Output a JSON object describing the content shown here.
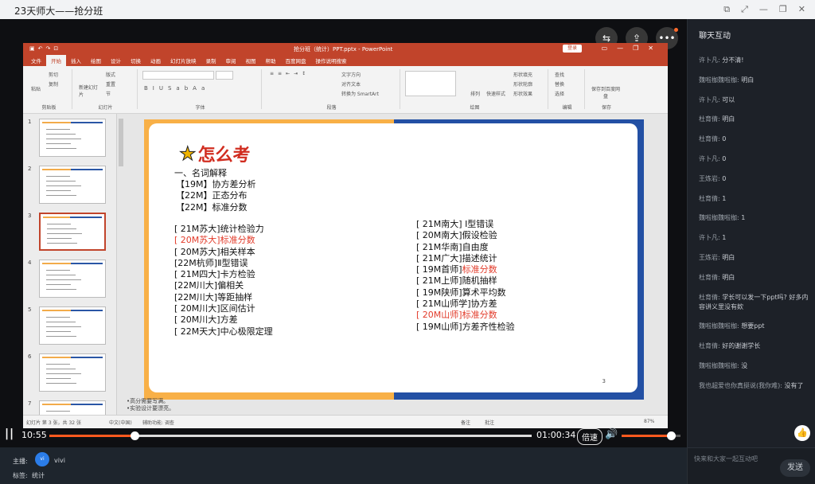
{
  "window": {
    "title": "23天师大——抢分班",
    "controls": [
      "⧉",
      "⤢",
      "—",
      "❐",
      "✕"
    ]
  },
  "player": {
    "current_time": "10:55",
    "total_time": "01:00:34",
    "speed_label": "倍速",
    "progress": 0.176,
    "volume_level": 0.85
  },
  "host": {
    "host_label": "主播:",
    "host_name": "vivi",
    "avatar_text": "vi",
    "tag_label": "标签:",
    "tag_value": "统计"
  },
  "ppt": {
    "file_title": "抢分班（统计）PPT.pptx - PowerPoint",
    "login_label": "登录",
    "tabs": [
      "文件",
      "开始",
      "插入",
      "绘图",
      "设计",
      "切换",
      "动画",
      "幻灯片放映",
      "录制",
      "审阅",
      "视图",
      "帮助",
      "百度网盘"
    ],
    "tell_me": "操作说明搜索",
    "ribbon_groups": [
      "剪贴板",
      "幻灯片",
      "字体",
      "段落",
      "绘图",
      "编辑",
      "保存"
    ],
    "ribbon_items": {
      "paste": "粘贴",
      "cut": "剪切",
      "copy": "复制",
      "new_slide": "新建幻灯片",
      "layout": "版式",
      "reset": "重置",
      "section": "节",
      "text_dir": "文字方向",
      "align_text": "对齐文本",
      "smartart": "转换为 SmartArt",
      "arrange": "排列",
      "quick_styles": "快速样式",
      "fill": "形状填充",
      "outline": "形状轮廓",
      "effect": "形状效果",
      "find": "查找",
      "replace": "替换",
      "select": "选择",
      "save_baidu": "保存到百度网盘"
    },
    "thumb_numbers": [
      "1",
      "2",
      "3",
      "4",
      "5",
      "6",
      "7"
    ],
    "notes": [
      "•高分需要写满。",
      "•实验设计要漂亮。"
    ],
    "status": {
      "slide_info": "幻灯片 第 3 张，共 32 张",
      "lang": "中文(中国)",
      "accessibility": "辅助功能: 调查",
      "notes_btn": "备注",
      "comments_btn": "批注",
      "zoom": "87%"
    }
  },
  "slide": {
    "title": "怎么考",
    "section_heading": "一、名词解释",
    "terms": [
      "【19M】协方差分析",
      "【22M】正态分布",
      "【22M】标准分数"
    ],
    "left_list": [
      {
        "text": "[ 21M苏大]统计检验力",
        "highlight": false
      },
      {
        "text": "[ 20M苏大]标准分数",
        "highlight": true
      },
      {
        "text": "[ 20M苏大]相关样本",
        "highlight": false
      },
      {
        "text": "[22M杭师]Ⅱ型错误",
        "highlight": false
      },
      {
        "text": "[ 21M四大]卡方检验",
        "highlight": false
      },
      {
        "text": "[22M川大]偏相关",
        "highlight": false
      },
      {
        "text": "[22M川大]等距抽样",
        "highlight": false
      },
      {
        "text": "[ 20M川大]区间估计",
        "highlight": false
      },
      {
        "text": "[ 20M川大]方差",
        "highlight": false
      },
      {
        "text": "[ 22M天大]中心极限定理",
        "highlight": false
      }
    ],
    "right_list": [
      {
        "prefix": "[ 21M南大] Ⅰ型错误",
        "suffix": ""
      },
      {
        "prefix": "[ 20M南大]假设检验",
        "suffix": ""
      },
      {
        "prefix": "[ 21M华南]自由度",
        "suffix": ""
      },
      {
        "prefix": "[ 21M广大]描述统计",
        "suffix": ""
      },
      {
        "prefix": "[ 19M首师]",
        "suffix": "标准分数"
      },
      {
        "prefix": "[ 21M上师]随机抽样",
        "suffix": ""
      },
      {
        "prefix": "[ 19M陕师]算术平均数",
        "suffix": ""
      },
      {
        "prefix": "[ 21M山师学]协方差",
        "suffix": ""
      },
      {
        "prefix": "",
        "suffix": "[ 20M山师]标准分数"
      },
      {
        "prefix": "[ 19M山师]方差齐性检验",
        "suffix": ""
      }
    ],
    "page_number": "3"
  },
  "chat": {
    "header": "聊天互动",
    "messages": [
      {
        "user": "许卜凡:",
        "text": "分不清!"
      },
      {
        "user": "魏啦枷魏啦枷:",
        "text": "明白"
      },
      {
        "user": "许卜凡:",
        "text": "可以"
      },
      {
        "user": "杜育倩:",
        "text": "明白"
      },
      {
        "user": "杜育倩:",
        "text": "0"
      },
      {
        "user": "许卜凡:",
        "text": "0"
      },
      {
        "user": "王炼岩:",
        "text": "0"
      },
      {
        "user": "杜育倩:",
        "text": "1"
      },
      {
        "user": "魏啦枷魏啦枷:",
        "text": "1"
      },
      {
        "user": "许卜凡:",
        "text": "1"
      },
      {
        "user": "王炼岩:",
        "text": "明白"
      },
      {
        "user": "杜育倩:",
        "text": "明白"
      },
      {
        "user": "杜育倩:",
        "text": "学长可以发一下ppt吗? 好多内容讲义里没有欸"
      },
      {
        "user": "魏啦枷魏啦枷:",
        "text": "想要ppt"
      },
      {
        "user": "杜育倩:",
        "text": "好的谢谢学长"
      },
      {
        "user": "魏啦枷魏啦枷:",
        "text": "没"
      },
      {
        "user": "我也超爱也你真挺说(我你难):",
        "text": "没有了"
      }
    ],
    "input_placeholder": "快来和大家一起互动吧",
    "send_label": "发送"
  },
  "colors": {
    "accent": "#ff5a1f",
    "ppt_brand": "#c1442b",
    "slide_orange": "#f8b047",
    "slide_blue": "#2350a4",
    "highlight_red": "#e23b2a"
  }
}
